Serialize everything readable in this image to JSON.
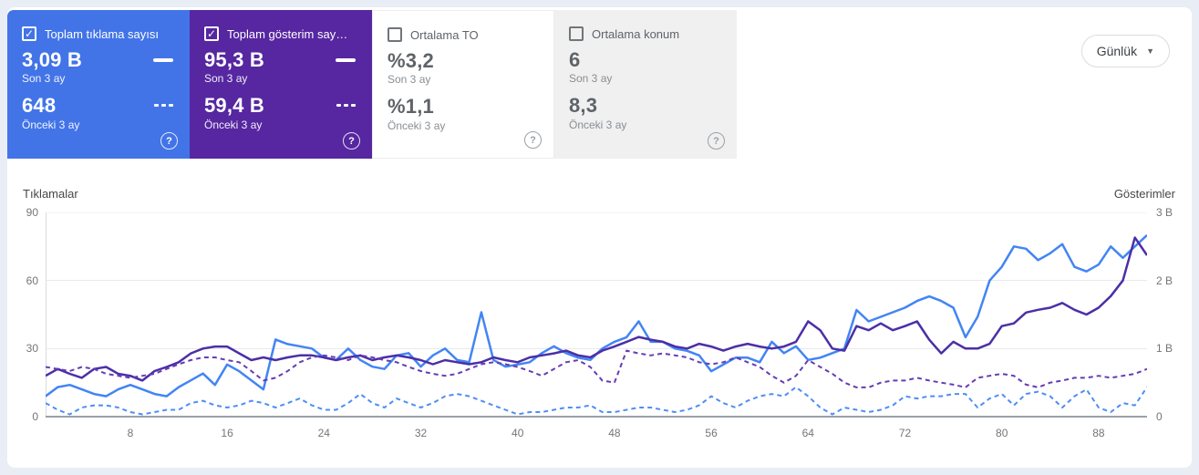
{
  "cards": [
    {
      "label": "Toplam tıklama sayısı",
      "checked": true,
      "current_value": "3,09 B",
      "current_label": "Son 3 ay",
      "previous_value": "648",
      "previous_label": "Önceki 3 ay",
      "bg": "#4274E8",
      "style": "dark"
    },
    {
      "label": "Toplam gösterim say…",
      "checked": true,
      "current_value": "95,3 B",
      "current_label": "Son 3 ay",
      "previous_value": "59,4 B",
      "previous_label": "Önceki 3 ay",
      "bg": "#5627A0",
      "style": "dark"
    },
    {
      "label": "Ortalama TO",
      "checked": false,
      "current_value": "%3,2",
      "current_label": "Son 3 ay",
      "previous_value": "%1,1",
      "previous_label": "Önceki 3 ay",
      "bg": "#FFFFFF",
      "style": "light"
    },
    {
      "label": "Ortalama konum",
      "checked": false,
      "current_value": "6",
      "current_label": "Son 3 ay",
      "previous_value": "8,3",
      "previous_label": "Önceki 3 ay",
      "bg": "#F0F0F0",
      "style": "light"
    }
  ],
  "toolbar": {
    "granularity_label": "Günlük"
  },
  "icons": {
    "check": "✓",
    "caret": "▼",
    "help": "?"
  },
  "colors": {
    "page_bg": "#E9EEF6",
    "panel_bg": "#FFFFFF",
    "clicks_card": "#4274E8",
    "impressions_card": "#5627A0",
    "grid": "#E8E8E8",
    "axis_line": "#9AA0A6",
    "tick_text": "#757575"
  },
  "chart_data": {
    "type": "line",
    "left_axis": {
      "label": "Tıklamalar",
      "max": 90,
      "ticks": [
        {
          "label": "90",
          "value": 90
        },
        {
          "label": "60",
          "value": 60
        },
        {
          "label": "30",
          "value": 30
        },
        {
          "label": "0",
          "value": 0
        }
      ]
    },
    "right_axis": {
      "label": "Gösterimler",
      "max": 3,
      "ticks": [
        {
          "label": "3 B",
          "value": 3
        },
        {
          "label": "2 B",
          "value": 2
        },
        {
          "label": "1 B",
          "value": 1
        },
        {
          "label": "0",
          "value": 0
        }
      ]
    },
    "x_axis": {
      "ticks": [
        8,
        16,
        24,
        32,
        40,
        48,
        56,
        64,
        72,
        80,
        88
      ]
    },
    "grid": true,
    "series": [
      {
        "name": "Tıklamalar – Son 3 ay",
        "axis": "left",
        "style": "solid",
        "color": "#4285F4",
        "values": [
          9,
          13,
          14,
          12,
          10,
          9,
          12,
          14,
          12,
          10,
          9,
          13,
          16,
          19,
          14,
          23,
          20,
          16,
          12,
          34,
          32,
          31,
          30,
          26,
          25,
          30,
          25,
          22,
          21,
          27,
          28,
          22,
          27,
          30,
          25,
          24,
          46,
          25,
          22,
          23,
          24,
          28,
          31,
          28,
          26,
          25,
          30,
          33,
          35,
          42,
          33,
          33,
          30,
          29,
          27,
          20,
          23,
          26,
          26,
          24,
          33,
          28,
          31,
          25,
          26,
          28,
          30,
          47,
          42,
          44,
          46,
          48,
          51,
          53,
          51,
          48,
          35,
          44,
          60,
          66,
          75,
          74,
          69,
          72,
          76,
          66,
          64,
          67,
          75,
          70,
          75,
          80
        ]
      },
      {
        "name": "Tıklamalar – Önceki 3 ay",
        "axis": "left",
        "style": "dashed",
        "color": "#4E8EF4",
        "values": [
          6,
          3,
          1,
          4,
          5,
          5,
          4,
          2,
          1,
          2,
          3,
          3,
          6,
          7,
          5,
          4,
          5,
          7,
          6,
          4,
          6,
          8,
          5,
          3,
          3,
          6,
          10,
          6,
          4,
          8,
          6,
          4,
          6,
          9,
          10,
          9,
          7,
          5,
          3,
          1,
          2,
          2,
          3,
          4,
          4,
          5,
          2,
          2,
          3,
          4,
          4,
          3,
          2,
          3,
          5,
          9,
          6,
          4,
          7,
          9,
          10,
          9,
          13,
          9,
          4,
          1,
          4,
          3,
          2,
          3,
          5,
          9,
          8,
          9,
          9,
          10,
          10,
          4,
          8,
          10,
          5,
          10,
          11,
          9,
          4,
          9,
          12,
          4,
          2,
          6,
          5,
          13
        ]
      },
      {
        "name": "Gösterimler – Son 3 ay",
        "axis": "right",
        "style": "solid",
        "color": "#4B2FA6",
        "values": [
          0.6,
          0.7,
          0.63,
          0.57,
          0.7,
          0.73,
          0.63,
          0.6,
          0.53,
          0.67,
          0.73,
          0.8,
          0.93,
          1.0,
          1.03,
          1.03,
          0.93,
          0.83,
          0.87,
          0.83,
          0.87,
          0.9,
          0.9,
          0.87,
          0.83,
          0.87,
          0.9,
          0.83,
          0.87,
          0.9,
          0.87,
          0.83,
          0.77,
          0.83,
          0.8,
          0.77,
          0.8,
          0.87,
          0.83,
          0.8,
          0.87,
          0.9,
          0.93,
          0.97,
          0.9,
          0.87,
          0.97,
          1.03,
          1.1,
          1.17,
          1.13,
          1.1,
          1.03,
          1.0,
          1.07,
          1.03,
          0.97,
          1.03,
          1.07,
          1.03,
          1.0,
          1.03,
          1.1,
          1.4,
          1.27,
          1.0,
          0.97,
          1.33,
          1.27,
          1.37,
          1.27,
          1.33,
          1.4,
          1.13,
          0.93,
          1.1,
          1.0,
          1.0,
          1.07,
          1.33,
          1.37,
          1.53,
          1.57,
          1.6,
          1.67,
          1.57,
          1.5,
          1.6,
          1.77,
          2.0,
          2.63,
          2.37
        ]
      },
      {
        "name": "Gösterimler – Önceki 3 ay",
        "axis": "right",
        "style": "dashed",
        "color": "#653CB3",
        "values": [
          0.73,
          0.7,
          0.67,
          0.73,
          0.7,
          0.63,
          0.6,
          0.57,
          0.6,
          0.63,
          0.7,
          0.77,
          0.83,
          0.87,
          0.87,
          0.83,
          0.8,
          0.67,
          0.53,
          0.57,
          0.67,
          0.8,
          0.87,
          0.9,
          0.87,
          0.83,
          0.9,
          0.87,
          0.83,
          0.8,
          0.73,
          0.67,
          0.63,
          0.6,
          0.63,
          0.7,
          0.77,
          0.8,
          0.77,
          0.73,
          0.67,
          0.6,
          0.7,
          0.8,
          0.83,
          0.73,
          0.53,
          0.5,
          0.97,
          0.93,
          0.9,
          0.93,
          0.9,
          0.87,
          0.8,
          0.77,
          0.8,
          0.87,
          0.8,
          0.73,
          0.6,
          0.5,
          0.6,
          0.83,
          0.73,
          0.63,
          0.5,
          0.43,
          0.43,
          0.5,
          0.53,
          0.53,
          0.57,
          0.53,
          0.5,
          0.47,
          0.43,
          0.57,
          0.6,
          0.63,
          0.6,
          0.47,
          0.43,
          0.5,
          0.53,
          0.57,
          0.57,
          0.6,
          0.57,
          0.6,
          0.63,
          0.7
        ]
      }
    ]
  }
}
